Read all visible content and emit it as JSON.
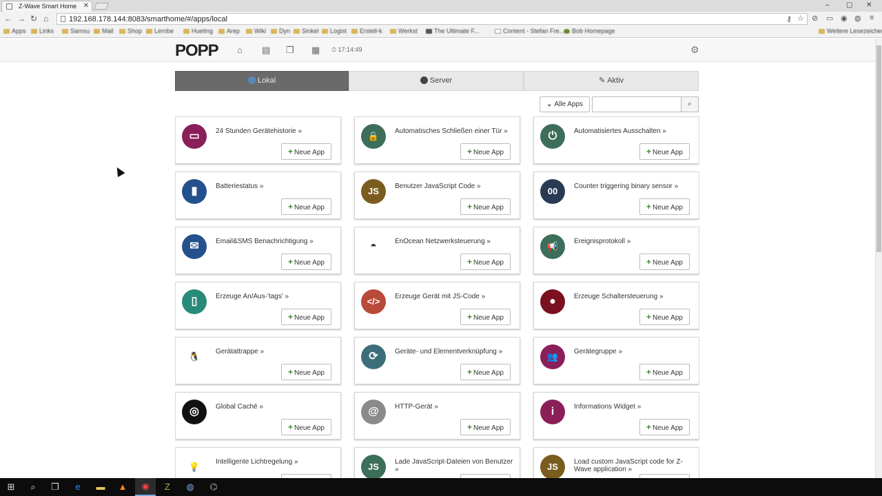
{
  "browser": {
    "tab_title": "Z-Wave Smart Home",
    "url": "192.168.178.144:8083/smarthome/#/apps/local",
    "bookmarks": [
      "Apps",
      "Links",
      "Samsu",
      "Mail",
      "Shop",
      "Lernbe",
      "Hueting",
      "Arep",
      "Wiki",
      "Dyn",
      "Sinkel",
      "Logist",
      "Erstell-k",
      "Werkst",
      "The Ultimate F...",
      "Content - Stefan Fre...",
      "Bob Homepage",
      "Weitere Lesezeichen"
    ],
    "window_controls": [
      "–",
      "▢",
      "✕"
    ]
  },
  "app": {
    "logo": "POPP",
    "clock": "17:14:49",
    "segments": [
      {
        "label": "Lokal",
        "active": true
      },
      {
        "label": "Server",
        "active": false
      },
      {
        "label": "Aktiv",
        "active": false
      }
    ],
    "filter": {
      "label": "Alle Apps",
      "search_placeholder": ""
    },
    "new_app_label": "Neue App",
    "apps": [
      {
        "name": "24 Stunden Gerätehistorie »",
        "icon": "chart-icon",
        "color": "#8a1f5a",
        "glyph": "▭"
      },
      {
        "name": "Automatisches Schließen einer Tür »",
        "icon": "lock-icon",
        "color": "#3c6e5a",
        "glyph": "🔒"
      },
      {
        "name": "Automatisiertes Ausschalten »",
        "icon": "power-icon",
        "color": "#3c6e5a",
        "glyph": "⏻"
      },
      {
        "name": "Batteriestatus »",
        "icon": "battery-icon",
        "color": "#24508e",
        "glyph": "▮"
      },
      {
        "name": "Benutzer JavaScript Code »",
        "icon": "js-icon",
        "color": "#7a5c1e",
        "glyph": "JS"
      },
      {
        "name": "Counter triggering binary sensor »",
        "icon": "counter-icon",
        "color": "#2a3a55",
        "glyph": "00"
      },
      {
        "name": "Email&SMS Benachrichtigung »",
        "icon": "mail-icon",
        "color": "#24508e",
        "glyph": "✉"
      },
      {
        "name": "EnOcean Netzwerksteuerung »",
        "icon": "enocean-icon",
        "color": "#ffffff",
        "glyph": "◓"
      },
      {
        "name": "Ereignisprotokoll »",
        "icon": "megaphone-icon",
        "color": "#3c6e5a",
        "glyph": "📢"
      },
      {
        "name": "Erzeuge An/Aus-'tags' »",
        "icon": "switch-icon",
        "color": "#2a8a7a",
        "glyph": "▯"
      },
      {
        "name": "Erzeuge Gerät mit JS-Code »",
        "icon": "code-icon",
        "color": "#b84a3a",
        "glyph": "</>"
      },
      {
        "name": "Erzeuge Schaltersteuerung »",
        "icon": "toggle-icon",
        "color": "#7a1020",
        "glyph": "●"
      },
      {
        "name": "Gerätattrappe »",
        "icon": "penguin-icon",
        "color": "#ffffff",
        "glyph": "🐧"
      },
      {
        "name": "Geräte- und Elementverknüpfung »",
        "icon": "link-icon",
        "color": "#3c6e7a",
        "glyph": "⟳"
      },
      {
        "name": "Gerätegruppe »",
        "icon": "group-icon",
        "color": "#8a1f5a",
        "glyph": "👥"
      },
      {
        "name": "Global Caché »",
        "icon": "globalcache-icon",
        "color": "#111111",
        "glyph": "◎"
      },
      {
        "name": "HTTP-Gerät »",
        "icon": "at-icon",
        "color": "#8a8a8a",
        "glyph": "@"
      },
      {
        "name": "Informations Widget »",
        "icon": "info-icon",
        "color": "#8a1f5a",
        "glyph": "i"
      },
      {
        "name": "Intelligente Lichtregelung »",
        "icon": "bulb-icon",
        "color": "#ffffff",
        "glyph": "💡"
      },
      {
        "name": "Lade JavaScript-Dateien von Benutzer »",
        "icon": "js-icon",
        "color": "#3c6e5a",
        "glyph": "JS"
      },
      {
        "name": "Load custom JavaScript code for Z-Wave application »",
        "icon": "js-icon",
        "color": "#7a5c1e",
        "glyph": "JS"
      }
    ]
  }
}
